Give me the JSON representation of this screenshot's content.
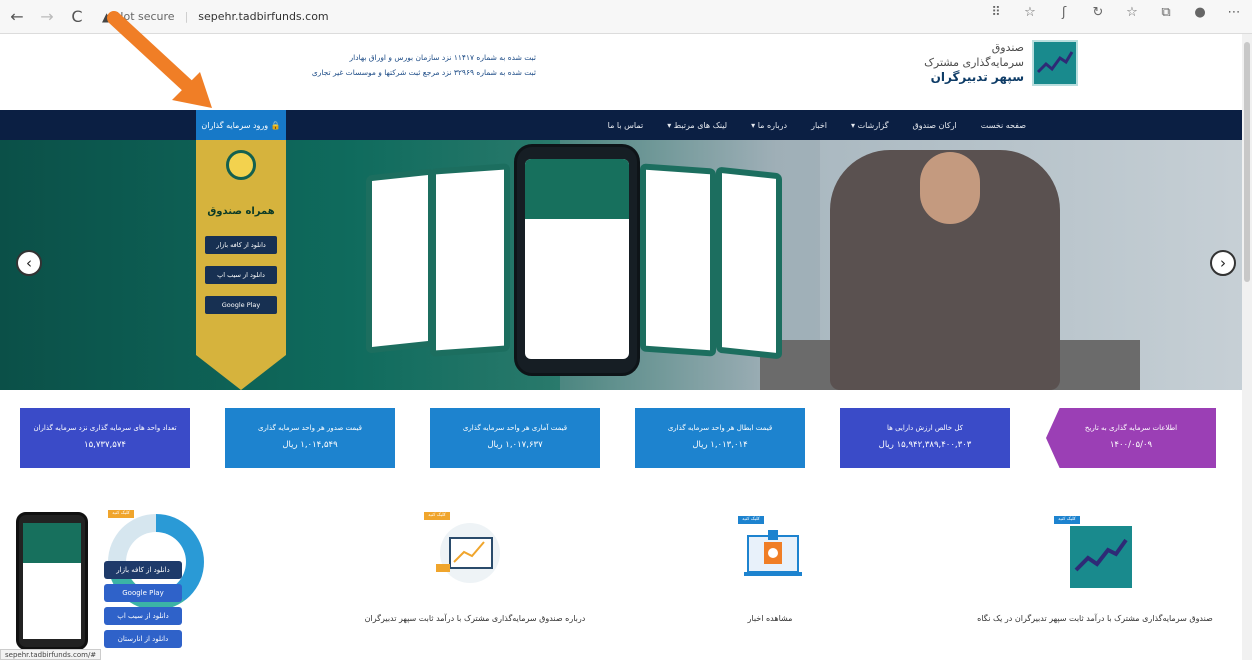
{
  "browser": {
    "back": "←",
    "forward": "→",
    "reload": "C",
    "not_secure": "Not secure",
    "url": "sepehr.tadbirfunds.com",
    "right_icons": [
      "⠿",
      "☆",
      "ʃ",
      "↻",
      "☆",
      "⧉",
      "●",
      "⋯"
    ]
  },
  "header": {
    "reg_line1": "ثبت شده به شماره ۱۱۴۱۷ نزد سازمان بورس و اوراق بهادار",
    "reg_line2": "ثبت شده به شماره ۳۲۹۶۹ نزد مرجع ثبت شرکتها و موسسات غیر تجاری",
    "logo_line1": "صندوق",
    "logo_line2": "سرمایه‌گذاری مشترک",
    "logo_line3": "سپهر تدبیرگران"
  },
  "menu": {
    "items": [
      "صفحه نخست",
      "ارکان صندوق",
      "گزارشات",
      "اخبار",
      "درباره ما",
      "لینک های مرتبط",
      "تماس با ما"
    ],
    "dropdown_marks": [
      "",
      "",
      "▾",
      "",
      "▾",
      "▾",
      ""
    ],
    "login": "ورود سرمایه گذاران"
  },
  "hero": {
    "ribbon_title": "همراه صندوق",
    "stores": [
      "دانلود از کافه بازار",
      "دانلود از سیب اپ",
      "Google Play"
    ],
    "prev": "‹",
    "next": "›"
  },
  "stats": [
    {
      "title": "اطلاعات سرمایه گذاری به تاریخ",
      "value": "۱۴۰۰/۰۵/۰۹",
      "color": "#9b3fb5"
    },
    {
      "title": "کل خالص ارزش دارایی ها",
      "value": "۱۵,۹۴۲,۳۸۹,۴۰۰,۳۰۳ ریال",
      "color": "#3a4bc8"
    },
    {
      "title": "قیمت ابطال هر واحد سرمایه گذاری",
      "value": "۱,۰۱۳,۰۱۴ ریال",
      "color": "#1d83cf"
    },
    {
      "title": "قیمت آماری هر واحد سرمایه گذاری",
      "value": "۱,۰۱۷,۶۳۷ ریال",
      "color": "#1d83cf"
    },
    {
      "title": "قیمت صدور هر واحد سرمایه گذاری",
      "value": "۱,۰۱۴,۵۴۹ ریال",
      "color": "#1d83cf"
    },
    {
      "title": "تعداد واحد های سرمایه گذاری نزد سرمایه گذاران",
      "value": "۱۵,۷۳۷,۵۷۴",
      "color": "#3a4bc8"
    }
  ],
  "features": [
    {
      "caption": "صندوق سرمایه‌گذاری مشترک با درآمد ثابت سپهر تدبیرگران در یک نگاه",
      "badge": "کلیک کنید"
    },
    {
      "caption": "مشاهده اخبار",
      "badge": "کلیک کنید"
    },
    {
      "caption": "درباره صندوق سرمایه‌گذاری مشترک با درآمد ثابت سپهر تدبیرگران",
      "badge": "کلیک کنید"
    }
  ],
  "promo": {
    "badge": "کلیک کنید",
    "buttons": [
      "دانلود از کافه بازار",
      "Google Play",
      "دانلود از سیب اپ",
      "دانلود از انارستان"
    ]
  },
  "status_url": "sepehr.tadbirfunds.com/#",
  "colors": {
    "navy": "#0b1f43",
    "login": "#1779c8",
    "arrow": "#f07e26"
  }
}
